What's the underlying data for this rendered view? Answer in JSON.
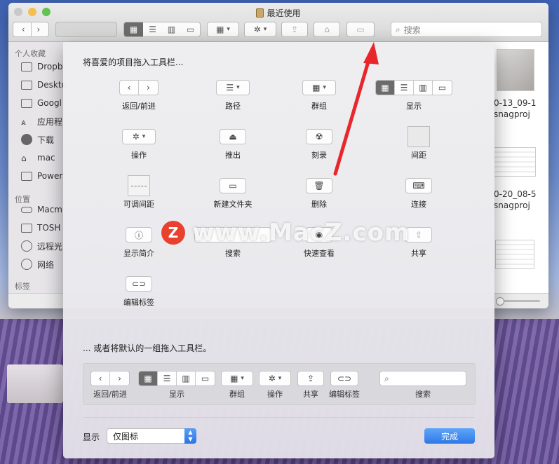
{
  "window": {
    "title": "最近使用",
    "search_placeholder": "搜索"
  },
  "sidebar": {
    "favorites_header": "个人收藏",
    "favorites": [
      "Dropb",
      "Deskto",
      "Googl",
      "应用程",
      "下载",
      "mac",
      "Power"
    ],
    "locations_header": "位置",
    "locations": [
      "Macm",
      "TOSH",
      "远程光",
      "网络"
    ],
    "tags_header": "标签"
  },
  "files": {
    "items": [
      "0-13_09-1",
      "snagproj",
      "0-20_08-5",
      "snagproj"
    ]
  },
  "sheet": {
    "prompt": "将喜爱的项目拖入工具栏...",
    "items": [
      {
        "label": "返回/前进",
        "icon": "back-forward-icon"
      },
      {
        "label": "路径",
        "icon": "path-icon"
      },
      {
        "label": "群组",
        "icon": "group-icon"
      },
      {
        "label": "显示",
        "icon": "view-icon"
      },
      {
        "label": "操作",
        "icon": "gear-icon"
      },
      {
        "label": "推出",
        "icon": "eject-icon"
      },
      {
        "label": "刻录",
        "icon": "burn-icon"
      },
      {
        "label": "间距",
        "icon": "space-icon"
      },
      {
        "label": "可调间距",
        "icon": "flexible-space-icon"
      },
      {
        "label": "新建文件夹",
        "icon": "new-folder-icon"
      },
      {
        "label": "删除",
        "icon": "trash-icon"
      },
      {
        "label": "连接",
        "icon": "connect-icon"
      },
      {
        "label": "显示简介",
        "icon": "info-icon"
      },
      {
        "label": "搜索",
        "icon": "search-icon"
      },
      {
        "label": "快速查看",
        "icon": "eye-icon"
      },
      {
        "label": "共享",
        "icon": "share-icon"
      },
      {
        "label": "编辑标签",
        "icon": "tag-icon"
      }
    ],
    "prompt_default": "... 或者将默认的一组拖入工具栏。",
    "default_items": [
      "返回/前进",
      "显示",
      "群组",
      "操作",
      "共享",
      "编辑标签",
      "搜索"
    ],
    "show_label": "显示",
    "show_value": "仅图标",
    "done_label": "完成"
  },
  "watermark": {
    "logo": "Z",
    "text": "www.MacZ.com"
  },
  "colors": {
    "accent": "#2f78e8",
    "arrow": "#e8262b",
    "selected_segment": "#6b6b6b"
  }
}
